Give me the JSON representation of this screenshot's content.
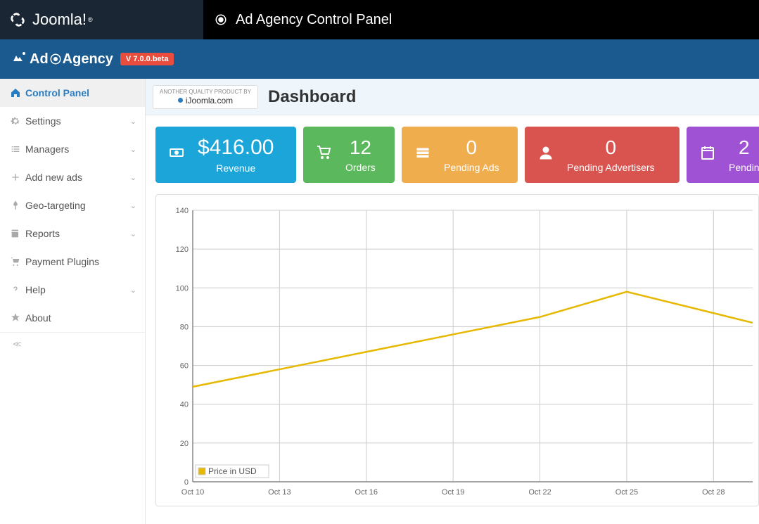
{
  "topbar": {
    "brand": "Joomla!",
    "title": "Ad Agency Control Panel"
  },
  "subheader": {
    "product_prefix": "Ad",
    "product_suffix": "Agency",
    "version": "V 7.0.0.beta"
  },
  "sidebar": {
    "items": [
      {
        "label": "Control Panel",
        "icon": "home",
        "active": true,
        "expandable": false
      },
      {
        "label": "Settings",
        "icon": "gear",
        "active": false,
        "expandable": true
      },
      {
        "label": "Managers",
        "icon": "list",
        "active": false,
        "expandable": true
      },
      {
        "label": "Add new ads",
        "icon": "plus",
        "active": false,
        "expandable": true
      },
      {
        "label": "Geo-targeting",
        "icon": "pin",
        "active": false,
        "expandable": true
      },
      {
        "label": "Reports",
        "icon": "report",
        "active": false,
        "expandable": true
      },
      {
        "label": "Payment Plugins",
        "icon": "cart",
        "active": false,
        "expandable": false
      },
      {
        "label": "Help",
        "icon": "question",
        "active": false,
        "expandable": true
      },
      {
        "label": "About",
        "icon": "star",
        "active": false,
        "expandable": false
      }
    ]
  },
  "main": {
    "quality_line": "ANOTHER QUALITY PRODUCT BY",
    "quality_domain": "iJoomla.com",
    "page_title": "Dashboard"
  },
  "stats": [
    {
      "value": "$416.00",
      "label": "Revenue",
      "icon": "money"
    },
    {
      "value": "12",
      "label": "Orders",
      "icon": "cart"
    },
    {
      "value": "0",
      "label": "Pending Ads",
      "icon": "menu"
    },
    {
      "value": "0",
      "label": "Pending Advertisers",
      "icon": "user"
    },
    {
      "value": "2",
      "label": "Pendin",
      "icon": "calendar"
    }
  ],
  "chart_data": {
    "type": "line",
    "x": [
      "Oct 10",
      "Oct 13",
      "Oct 16",
      "Oct 19",
      "Oct 22",
      "Oct 25",
      "Oct 28"
    ],
    "y_ticks": [
      0,
      20,
      40,
      60,
      80,
      100,
      120,
      140
    ],
    "ylim": [
      0,
      140
    ],
    "legend": "Price in USD",
    "series": [
      {
        "name": "Price in USD",
        "values": [
          49,
          58,
          67,
          76,
          85,
          98,
          87
        ]
      }
    ],
    "extra_right_x_fraction": 0.07,
    "extra_right_value": 82
  }
}
